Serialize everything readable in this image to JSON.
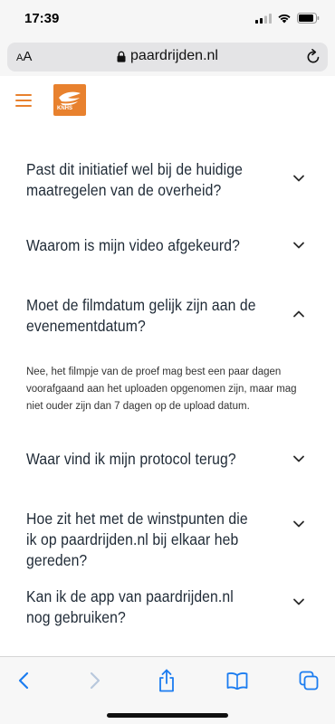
{
  "status_bar": {
    "time": "17:39"
  },
  "browser": {
    "aa_label_small": "A",
    "aa_label_large": "A",
    "url": "paardrijden.nl"
  },
  "site": {
    "logo_text": "KNHS",
    "brand_color": "#e8812e"
  },
  "faq": {
    "items": [
      {
        "question": "Past dit initiatief wel bij de huidige maatregelen van de overheid?",
        "expanded": false
      },
      {
        "question": "Waarom is mijn video afgekeurd?",
        "expanded": false
      },
      {
        "question": "Moet de filmdatum gelijk zijn aan de evenementdatum?",
        "expanded": true,
        "answer": "Nee, het filmpje van de proef mag best een paar dagen voorafgaand aan het uploaden opgenomen zijn, maar mag niet ouder zijn dan 7 dagen op de upload datum."
      },
      {
        "question": "Waar vind ik mijn protocol terug?",
        "expanded": false
      },
      {
        "question": "Hoe zit het met de winstpunten die ik op paardrijden.nl bij elkaar heb gereden?",
        "expanded": false
      },
      {
        "question": "Kan ik de app van paardrijden.nl nog gebruiken?",
        "expanded": false
      }
    ]
  },
  "toolbar": {
    "accent_color": "#1b7cf0",
    "disabled_color": "#b8c8dc",
    "icons": [
      "back-icon",
      "forward-icon",
      "share-icon",
      "bookmarks-icon",
      "tabs-icon"
    ]
  }
}
